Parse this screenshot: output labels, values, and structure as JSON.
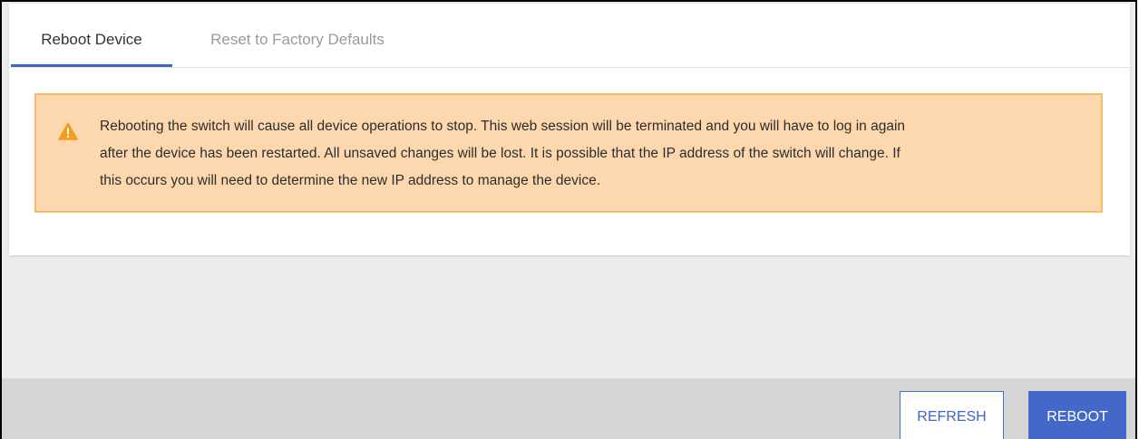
{
  "tabs": {
    "reboot_device": "Reboot Device",
    "reset_factory": "Reset to Factory Defaults"
  },
  "alert": {
    "icon": "warning-triangle-icon",
    "line1": "Rebooting the switch will cause all device operations to stop. This web session will be terminated and you will have to log in again",
    "line2": "after the device has been restarted. All unsaved changes will be lost. It is possible that the IP address of the switch will change. If",
    "line3": "this occurs you will need to determine the new IP address to manage the device."
  },
  "buttons": {
    "refresh": "REFRESH",
    "reboot": "REBOOT"
  },
  "colors": {
    "accent": "#3e64c4",
    "alert_bg": "#fdd8ae",
    "alert_border": "#f9b96a",
    "warning_icon": "#f39c1f"
  }
}
